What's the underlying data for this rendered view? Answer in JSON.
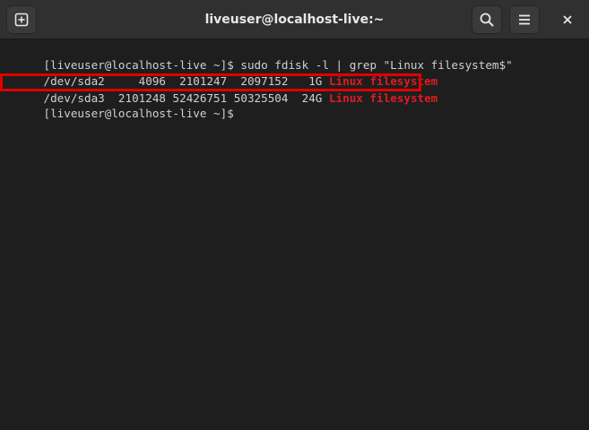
{
  "window": {
    "title": "liveuser@localhost-live:~"
  },
  "toolbar": {
    "new_tab_icon": "new-tab-icon",
    "search_icon": "search-icon",
    "menu_icon": "hamburger-menu-icon",
    "close_icon": "close-icon"
  },
  "terminal": {
    "lines": [
      {
        "text": "[liveuser@localhost-live ~]$ sudo fdisk -l | grep \"Linux filesystem$\""
      },
      {
        "text": "/dev/sda2     4096  2101247  2097152   1G ",
        "match": "Linux filesystem"
      },
      {
        "text": "/dev/sda3  2101248 52426751 50325504  24G ",
        "match": "Linux filesystem"
      },
      {
        "text": "[liveuser@localhost-live ~]$ "
      }
    ]
  },
  "colors": {
    "background": "#1e1e1e",
    "titlebar": "#303030",
    "text": "#d0d0d0",
    "match": "#e01b24",
    "highlight_box": "#e00000"
  }
}
